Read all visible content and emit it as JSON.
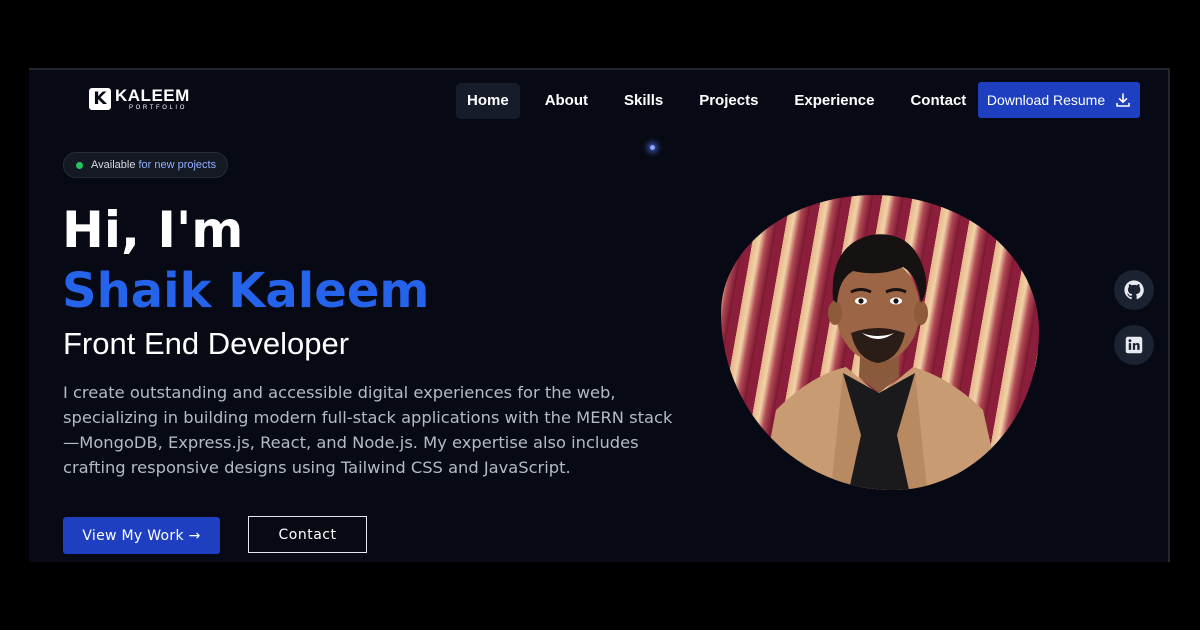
{
  "logo": {
    "mark": "K",
    "name": "KALEEM",
    "sub": "PORTFOLIO"
  },
  "nav": {
    "items": [
      {
        "label": "Home",
        "active": true
      },
      {
        "label": "About"
      },
      {
        "label": "Skills"
      },
      {
        "label": "Projects"
      },
      {
        "label": "Experience"
      },
      {
        "label": "Contact"
      }
    ],
    "resume_label": "Download Resume",
    "resume_icon": "download-icon"
  },
  "badge": {
    "text_a": "Available",
    "text_b": "for new projects",
    "status_color": "#22c55e"
  },
  "hero": {
    "greeting": "Hi, I'm",
    "name": "Shaik Kaleem",
    "role": "Front End Developer",
    "description_lines": [
      "I create outstanding and accessible digital experiences for the web,",
      "specializing in building modern full-stack applications with the MERN stack",
      "—MongoDB, Express.js, React, and Node.js. My expertise also includes",
      "crafting responsive designs using Tailwind CSS and JavaScript."
    ],
    "primary_button": "View My Work →",
    "secondary_button": "Contact"
  },
  "social": [
    {
      "icon": "github-icon"
    },
    {
      "icon": "linkedin-icon"
    }
  ],
  "colors": {
    "accent": "#2563eb",
    "button": "#1e3fbf",
    "background": "#070a14"
  }
}
